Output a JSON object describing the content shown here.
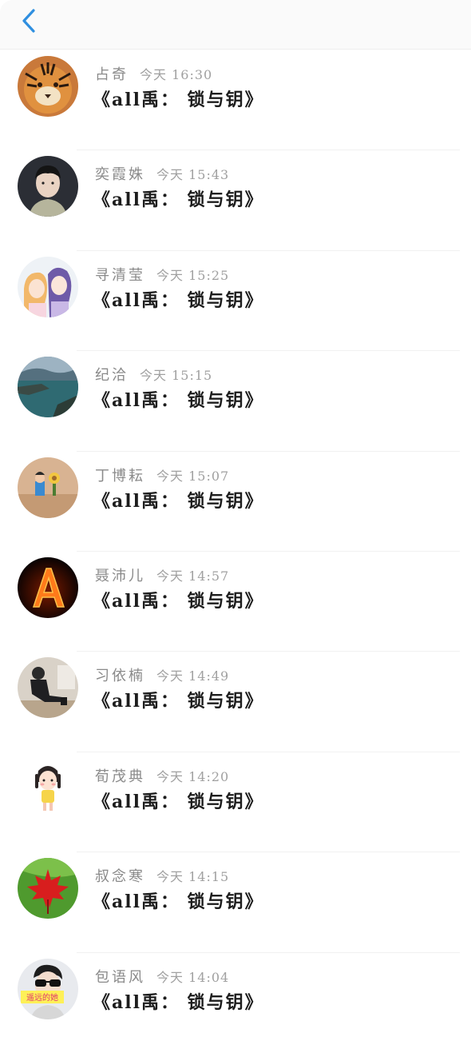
{
  "header": {
    "back_icon": "chevron-left-icon",
    "accent_color": "#2f8fe0"
  },
  "list": {
    "items": [
      {
        "name": "占奇",
        "time": "今天 16:30",
        "title": "《all禹： 锁与钥》",
        "avatar": "tiger"
      },
      {
        "name": "奕霞姝",
        "time": "今天 15:43",
        "title": "《all禹： 锁与钥》",
        "avatar": "boy-portrait"
      },
      {
        "name": "寻清莹",
        "time": "今天 15:25",
        "title": "《all禹： 锁与钥》",
        "avatar": "anime-couple"
      },
      {
        "name": "纪洽",
        "time": "今天 15:15",
        "title": "《all禹： 锁与钥》",
        "avatar": "seascape"
      },
      {
        "name": "丁博耘",
        "time": "今天 15:07",
        "title": "《all禹： 锁与钥》",
        "avatar": "toy-figures"
      },
      {
        "name": "聂沛儿",
        "time": "今天 14:57",
        "title": "《all禹： 锁与钥》",
        "avatar": "fire-letter-a"
      },
      {
        "name": "习依楠",
        "time": "今天 14:49",
        "title": "《all禹： 锁与钥》",
        "avatar": "person-sitting"
      },
      {
        "name": "荀茂典",
        "time": "今天 14:20",
        "title": "《all禹： 锁与钥》",
        "avatar": "cartoon-girl"
      },
      {
        "name": "叔念寒",
        "time": "今天 14:15",
        "title": "《all禹： 锁与钥》",
        "avatar": "red-maple-leaf"
      },
      {
        "name": "包语风",
        "time": "今天 14:04",
        "title": "《all禹： 锁与钥》",
        "avatar": "sunglasses-boy",
        "avatar_caption": "遥远的她"
      }
    ]
  }
}
